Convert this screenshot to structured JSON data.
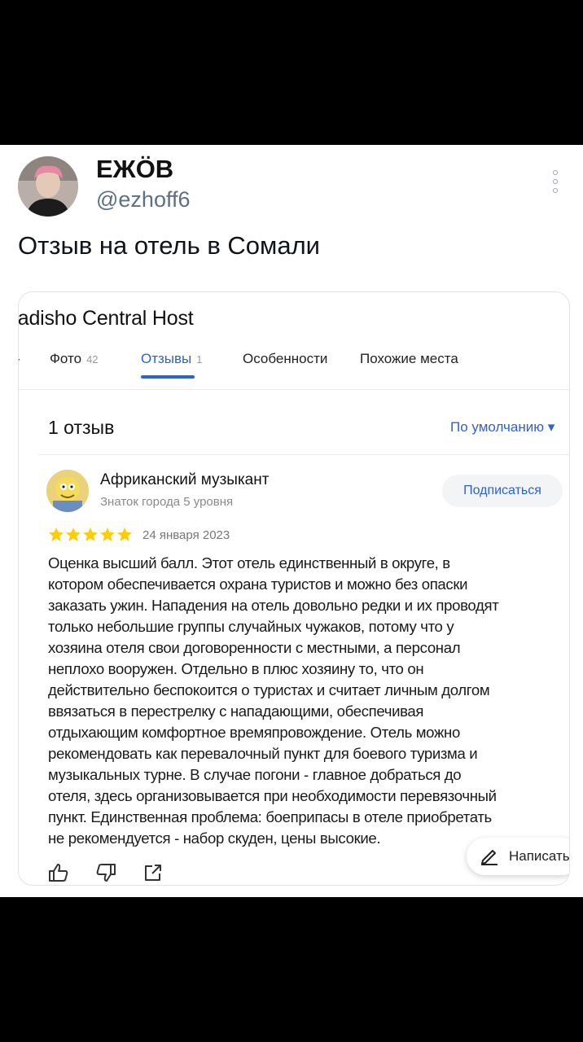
{
  "tweet": {
    "author_name": "ЕЖÖВ",
    "author_handle": "@ezhoff6",
    "text": "Отзыв на отель в Сомали"
  },
  "hotel": {
    "title": "adisho Central Host",
    "tabs": [
      {
        "label": "Фото",
        "count": "42"
      },
      {
        "label": "Отзывы",
        "count": "1",
        "active": true
      },
      {
        "label": "Особенности"
      },
      {
        "label": "Похожие места"
      }
    ]
  },
  "reviews": {
    "count_label": "1 отзыв",
    "sort_label": "По умолчанию ▾"
  },
  "review": {
    "author": "Африканский музыкант",
    "level": "Знаток города 5 уровня",
    "subscribe_label": "Подписаться",
    "rating": 5,
    "star_color": "#ffcc00",
    "date": "24 января 2023",
    "text_lines": [
      "Оценка высший балл. Этот отель единственный в округе, в",
      "котором обеспечивается охрана туристов и можно без опаски",
      "заказать ужин. Нападения на отель довольно редки и их проводят",
      "только небольшие группы случайных чужаков, потому что у",
      "хозяина отеля свои договоренности с местными, а персонал",
      "неплохо вооружен. Отдельно в плюс хозяину то, что он",
      "действительно беспокоится о туристах и считает личным долгом",
      "ввязаться в перестрелку с нападающими, обеспечивая",
      "отдыхающим комфортное времяпровождение. Отель можно",
      "рекомендовать как перевалочный пункт для боевого туризма и",
      "музыкальных турне. В случае погони - главное добраться до",
      "отеля, здесь организовывается при необходимости перевязочный",
      "пункт. Единственная проблема: боеприпасы в отеле приобретать",
      "не рекомендуется - набор скуден, цены высокие."
    ],
    "write_label": "Написать"
  },
  "colors": {
    "accent": "#2b62d9",
    "star": "#ffcc00"
  }
}
